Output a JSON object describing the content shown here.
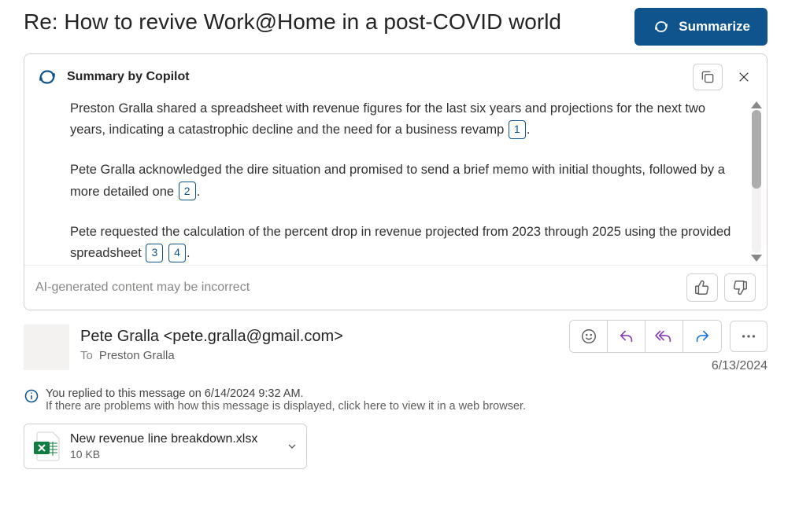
{
  "subject": "Re: How to revive Work@Home in a post-COVID world",
  "summarize_button": "Summarize",
  "copilot_panel": {
    "title": "Summary by Copilot",
    "paragraphs": [
      {
        "text_before": "Preston Gralla shared a spreadsheet with revenue figures for the last six years and projections for the next two years, indicating a catastrophic decline and the need for a business revamp ",
        "refs": [
          "1"
        ],
        "text_after": "."
      },
      {
        "text_before": "Pete Gralla acknowledged the dire situation and promised to send a brief memo with initial thoughts, followed by a more detailed one ",
        "refs": [
          "2"
        ],
        "text_after": "."
      },
      {
        "text_before": "Pete requested the calculation of the percent drop in revenue projected from 2023 through 2025 using the provided spreadsheet ",
        "refs": [
          "3",
          "4"
        ],
        "text_after": "."
      }
    ],
    "disclaimer": "AI-generated content may be incorrect"
  },
  "email": {
    "sender_display": "Pete Gralla <pete.gralla@gmail.com>",
    "to_label": "To",
    "to_value": "Preston Gralla",
    "date": "6/13/2024",
    "reply_info": "You replied to this message on 6/14/2024 9:32 AM.",
    "display_problem": "If there are problems with how this message is displayed, click here to view it in a web browser.",
    "attachment": {
      "name": "New revenue line breakdown.xlsx",
      "size": "10 KB"
    }
  }
}
